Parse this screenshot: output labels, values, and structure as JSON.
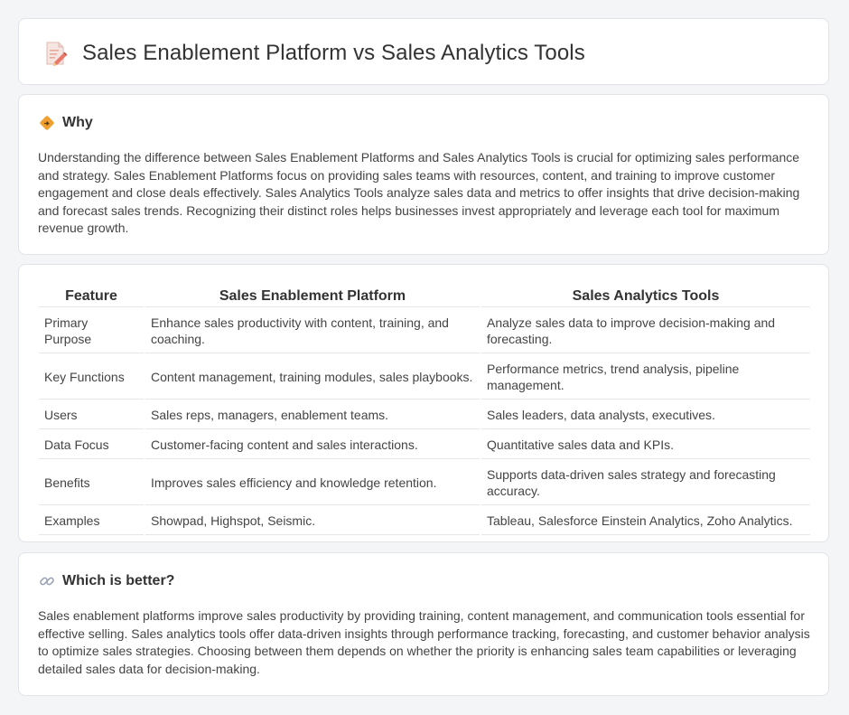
{
  "header": {
    "title": "Sales Enablement Platform vs Sales Analytics Tools",
    "icon": "document-pencil-icon"
  },
  "why": {
    "title": "Why",
    "icon": "diamond-sign-icon",
    "body": "Understanding the difference between Sales Enablement Platforms and Sales Analytics Tools is crucial for optimizing sales performance and strategy. Sales Enablement Platforms focus on providing sales teams with resources, content, and training to improve customer engagement and close deals effectively. Sales Analytics Tools analyze sales data and metrics to offer insights that drive decision-making and forecast sales trends. Recognizing their distinct roles helps businesses invest appropriately and leverage each tool for maximum revenue growth."
  },
  "table": {
    "headers": [
      "Feature",
      "Sales Enablement Platform",
      "Sales Analytics Tools"
    ],
    "rows": [
      [
        "Primary Purpose",
        "Enhance sales productivity with content, training, and coaching.",
        "Analyze sales data to improve decision-making and forecasting."
      ],
      [
        "Key Functions",
        "Content management, training modules, sales playbooks.",
        "Performance metrics, trend analysis, pipeline management."
      ],
      [
        "Users",
        "Sales reps, managers, enablement teams.",
        "Sales leaders, data analysts, executives."
      ],
      [
        "Data Focus",
        "Customer-facing content and sales interactions.",
        "Quantitative sales data and KPIs."
      ],
      [
        "Benefits",
        "Improves sales efficiency and knowledge retention.",
        "Supports data-driven sales strategy and forecasting accuracy."
      ],
      [
        "Examples",
        "Showpad, Highspot, Seismic.",
        "Tableau, Salesforce Einstein Analytics, Zoho Analytics."
      ]
    ]
  },
  "better": {
    "title": "Which is better?",
    "icon": "link-icon",
    "body": "Sales enablement platforms improve sales productivity by providing training, content management, and communication tools essential for effective selling. Sales analytics tools offer data-driven insights through performance tracking, forecasting, and customer behavior analysis to optimize sales strategies. Choosing between them depends on whether the priority is enhancing sales team capabilities or leveraging detailed sales data for decision-making."
  },
  "colors": {
    "background": "#f4f5f7",
    "card": "#ffffff",
    "border": "#e1e3e8",
    "icon_accent": "#f0a030",
    "icon_doc": "#e77a6a"
  }
}
